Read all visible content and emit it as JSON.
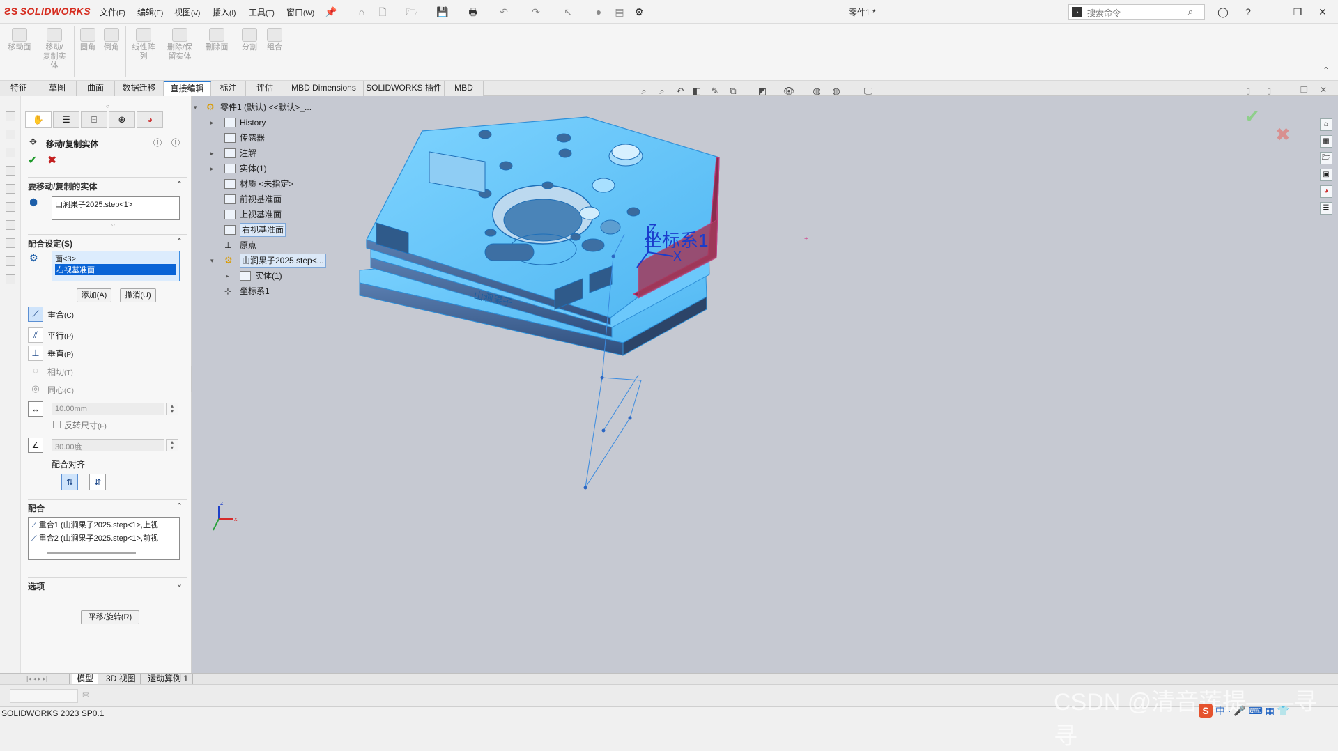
{
  "app": {
    "name": "SOLIDWORKS",
    "doc_title": "零件1 *",
    "version": "SOLIDWORKS 2023 SP0.1"
  },
  "menu": [
    {
      "label": "文件",
      "key": "(F)"
    },
    {
      "label": "编辑",
      "key": "(E)"
    },
    {
      "label": "视图",
      "key": "(V)"
    },
    {
      "label": "插入",
      "key": "(I)"
    },
    {
      "label": "工具",
      "key": "(T)"
    },
    {
      "label": "窗口",
      "key": "(W)"
    }
  ],
  "search": {
    "placeholder": "搜索命令"
  },
  "commands": [
    {
      "label": "移动面",
      "icon": "move-face-icon"
    },
    {
      "label": "移动/\n复制实\n体",
      "icon": "move-copy-body-icon"
    },
    {
      "label": "圆角",
      "icon": "fillet-icon"
    },
    {
      "label": "倒角",
      "icon": "chamfer-icon"
    },
    {
      "label": "线性阵\n列",
      "icon": "linear-pattern-icon"
    },
    {
      "label": "删除/保\n留实体",
      "icon": "delete-keep-body-icon"
    },
    {
      "label": "删除面",
      "icon": "delete-face-icon"
    },
    {
      "label": "分割",
      "icon": "split-icon"
    },
    {
      "label": "组合",
      "icon": "combine-icon"
    }
  ],
  "tabs": [
    "特征",
    "草图",
    "曲面",
    "数据迁移",
    "直接编辑",
    "标注",
    "评估",
    "MBD Dimensions",
    "SOLIDWORKS 插件",
    "MBD"
  ],
  "active_tab": "直接编辑",
  "property_manager": {
    "title": "移动/复制实体",
    "bodies_section": "要移动/复制的实体",
    "bodies": [
      "山涧果子2025.step<1>"
    ],
    "mate_settings_section": "配合设定(S)",
    "mate_entities": [
      "面<3>",
      "右视基准面"
    ],
    "add_button": "添加(A)",
    "undo_button": "撤消(U)",
    "mate_types": [
      {
        "label": "重合",
        "key": "(C)",
        "active": true
      },
      {
        "label": "平行",
        "key": "(P)",
        "active": false
      },
      {
        "label": "垂直",
        "key": "(P)",
        "active": false
      },
      {
        "label": "相切",
        "key": "(T)",
        "active": false
      },
      {
        "label": "同心",
        "key": "(C)",
        "active": false
      }
    ],
    "distance_value": "10.00mm",
    "flip_dimension": "反转尺寸",
    "flip_dimension_key": "(F)",
    "angle_value": "30.00度",
    "mate_alignment": "配合对齐",
    "mates_section": "配合",
    "mates": [
      "重合1 (山涧果子2025.step<1>,上视",
      "重合2 (山涧果子2025.step<1>,前视"
    ],
    "options_section": "选项",
    "translate_rotate_button": "平移/旋转(R)"
  },
  "tree": {
    "root": "零件1 (默认) <<默认>_...",
    "items": [
      {
        "label": "History",
        "arrow": "▸",
        "indent": 0
      },
      {
        "label": "传感器",
        "arrow": "",
        "indent": 0
      },
      {
        "label": "注解",
        "arrow": "▸",
        "indent": 0
      },
      {
        "label": "实体(1)",
        "arrow": "▸",
        "indent": 0
      },
      {
        "label": "材质 <未指定>",
        "arrow": "",
        "indent": 0
      },
      {
        "label": "前视基准面",
        "arrow": "",
        "indent": 0
      },
      {
        "label": "上视基准面",
        "arrow": "",
        "indent": 0
      },
      {
        "label": "右视基准面",
        "arrow": "",
        "indent": 0,
        "selected": true
      },
      {
        "label": "原点",
        "arrow": "",
        "indent": 0
      },
      {
        "label": "山涧果子2025.step<...",
        "arrow": "▾",
        "indent": 0,
        "selected": true
      },
      {
        "label": "实体(1)",
        "arrow": "▸",
        "indent": 1
      },
      {
        "label": "坐标系1",
        "arrow": "",
        "indent": 0
      }
    ]
  },
  "viewport": {
    "coord_label": "坐标系1",
    "axis_z": "Z",
    "axis_x": "X",
    "engraving": "山涧果子",
    "triad_x": "x",
    "triad_z": "z"
  },
  "bottom_tabs": [
    "模型",
    "3D 视图",
    "运动算例 1"
  ],
  "watermark": "CSDN @清音莲提——寻寻",
  "ime": "中"
}
